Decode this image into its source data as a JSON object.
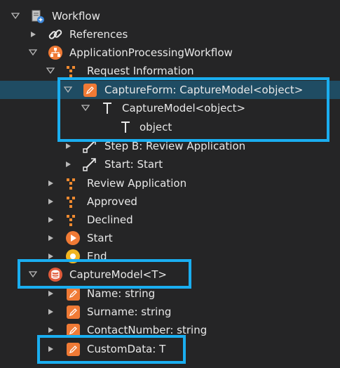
{
  "tree": {
    "root": {
      "label": "Workflow",
      "icon": "workflow-folder-icon"
    },
    "references": {
      "label": "References",
      "icon": "link-icon"
    },
    "app_workflow": {
      "label": "ApplicationProcessingWorkflow",
      "icon": "workflow-process-icon"
    },
    "request_info": {
      "label": "Request Information",
      "icon": "step-icon"
    },
    "capture_form": {
      "label": "CaptureForm: CaptureModel<object>",
      "icon": "edit-field-icon"
    },
    "capture_model_generic": {
      "label": "CaptureModel<object>",
      "icon": "type-icon"
    },
    "object_type": {
      "label": "object",
      "icon": "type-icon"
    },
    "step_b": {
      "label": "Step B: Review Application",
      "icon": "transition-icon"
    },
    "start_transition": {
      "label": "Start: Start",
      "icon": "transition-icon"
    },
    "review_app": {
      "label": "Review Application",
      "icon": "step-icon"
    },
    "approved": {
      "label": "Approved",
      "icon": "step-icon"
    },
    "declined": {
      "label": "Declined",
      "icon": "step-icon"
    },
    "start": {
      "label": "Start",
      "icon": "start-icon"
    },
    "end": {
      "label": "End",
      "icon": "end-icon"
    },
    "capture_model_t": {
      "label": "CaptureModel<T>",
      "icon": "database-icon"
    },
    "name_field": {
      "label": "Name: string",
      "icon": "edit-field-icon"
    },
    "surname_field": {
      "label": "Surname: string",
      "icon": "edit-field-icon"
    },
    "contact_field": {
      "label": "ContactNumber: string",
      "icon": "edit-field-icon"
    },
    "custom_data": {
      "label": "CustomData: T",
      "icon": "edit-field-icon"
    }
  },
  "colors": {
    "background": "#252526",
    "selection": "#1f4c63",
    "highlight_border": "#1aaef0",
    "field_icon": "#f07a35",
    "step_icon": "#f08a30"
  }
}
